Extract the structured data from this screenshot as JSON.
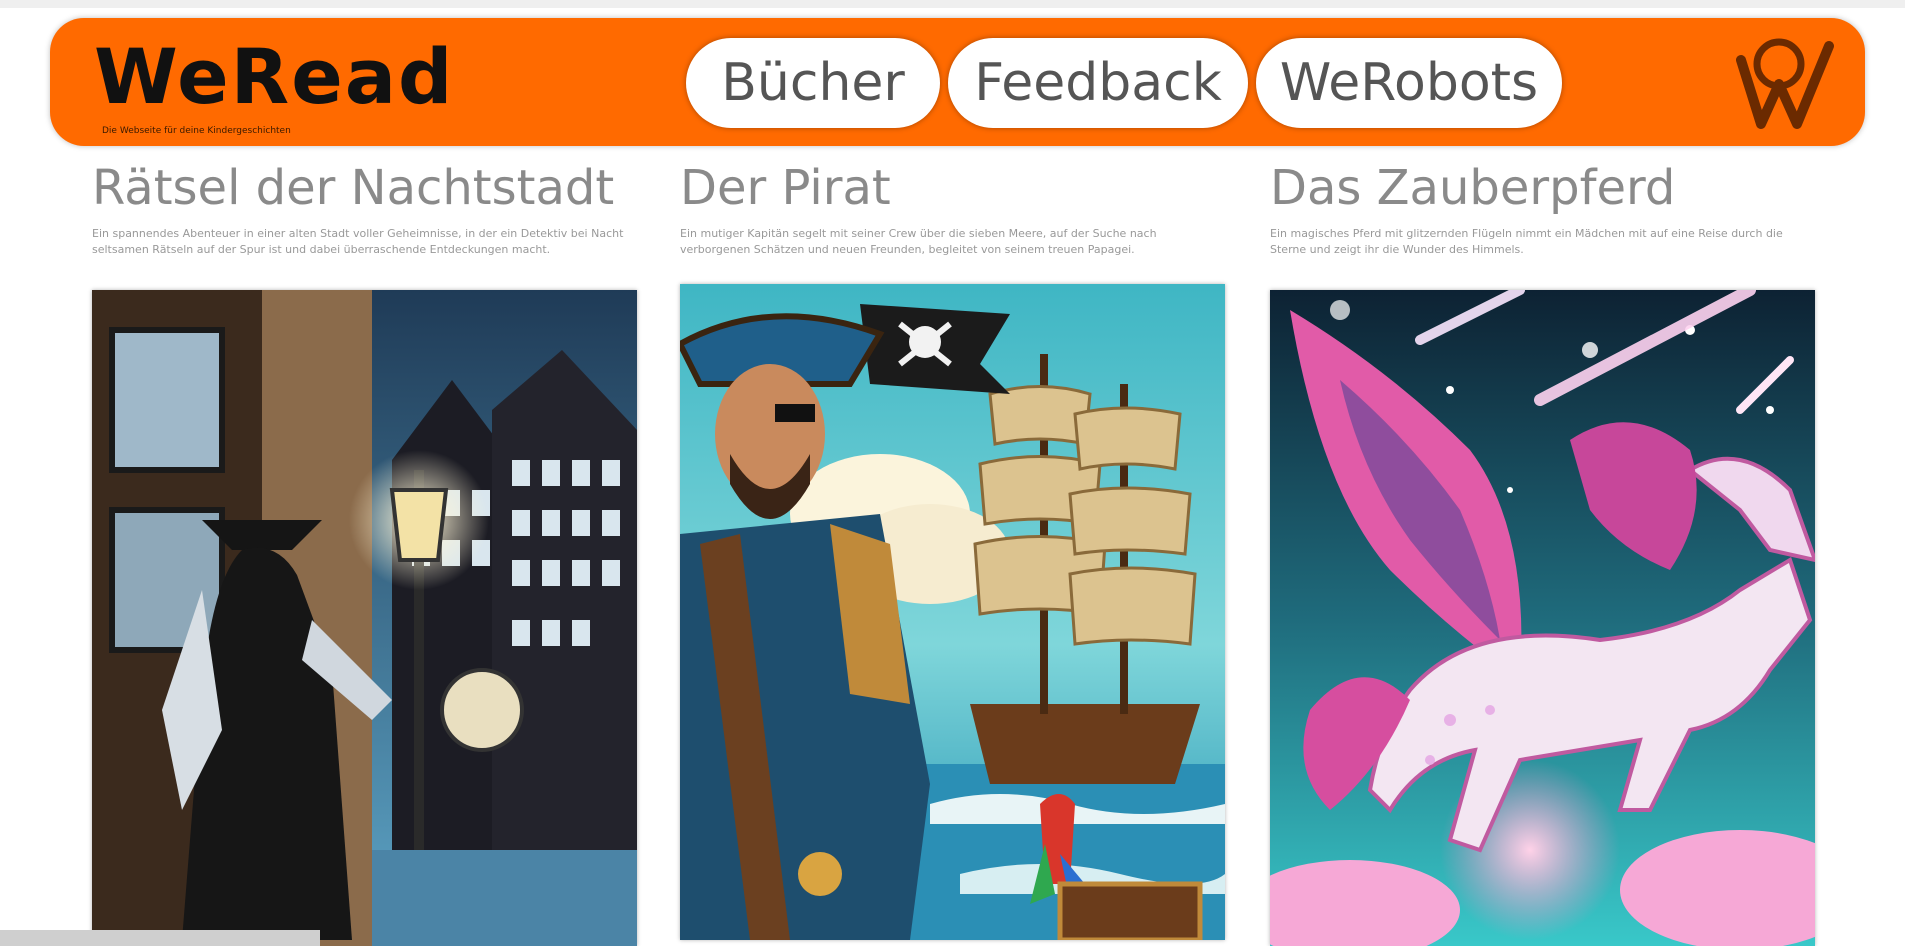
{
  "header": {
    "logo": "WeRead",
    "tagline": "Die Webseite für deine Kindergeschichten",
    "nav": [
      "Bücher",
      "Feedback",
      "WeRobots"
    ],
    "monogram_icon": "we-monogram-icon"
  },
  "colors": {
    "header_bg": "#ff6a00",
    "text_dark": "#111111",
    "title_gray": "#8a8a8a"
  },
  "books": [
    {
      "title": "Rätsel der Nachtstadt",
      "description": "Ein spannendes Abenteuer in einer alten Stadt voller Geheimnisse, in der ein Detektiv bei Nacht seltsamen Rätseln auf der Spur ist und dabei überraschende Entdeckungen macht.",
      "cover_alt": "Detektiv in einer nächtlichen Stadt mit Laterne"
    },
    {
      "title": "Der Pirat",
      "description": "Ein mutiger Kapitän segelt mit seiner Crew über die sieben Meere, auf der Suche nach verborgenen Schätzen und neuen Freunden, begleitet von seinem treuen Papagei.",
      "cover_alt": "Pirat mit Hut vor einem Segelschiff"
    },
    {
      "title": "Das Zauberpferd",
      "description": "Ein magisches Pferd mit glitzernden Flügeln nimmt ein Mädchen mit auf eine Reise durch die Sterne und zeigt ihr die Wunder des Himmels.",
      "cover_alt": "Geflügeltes Einhorn im Sternenhimmel"
    }
  ]
}
